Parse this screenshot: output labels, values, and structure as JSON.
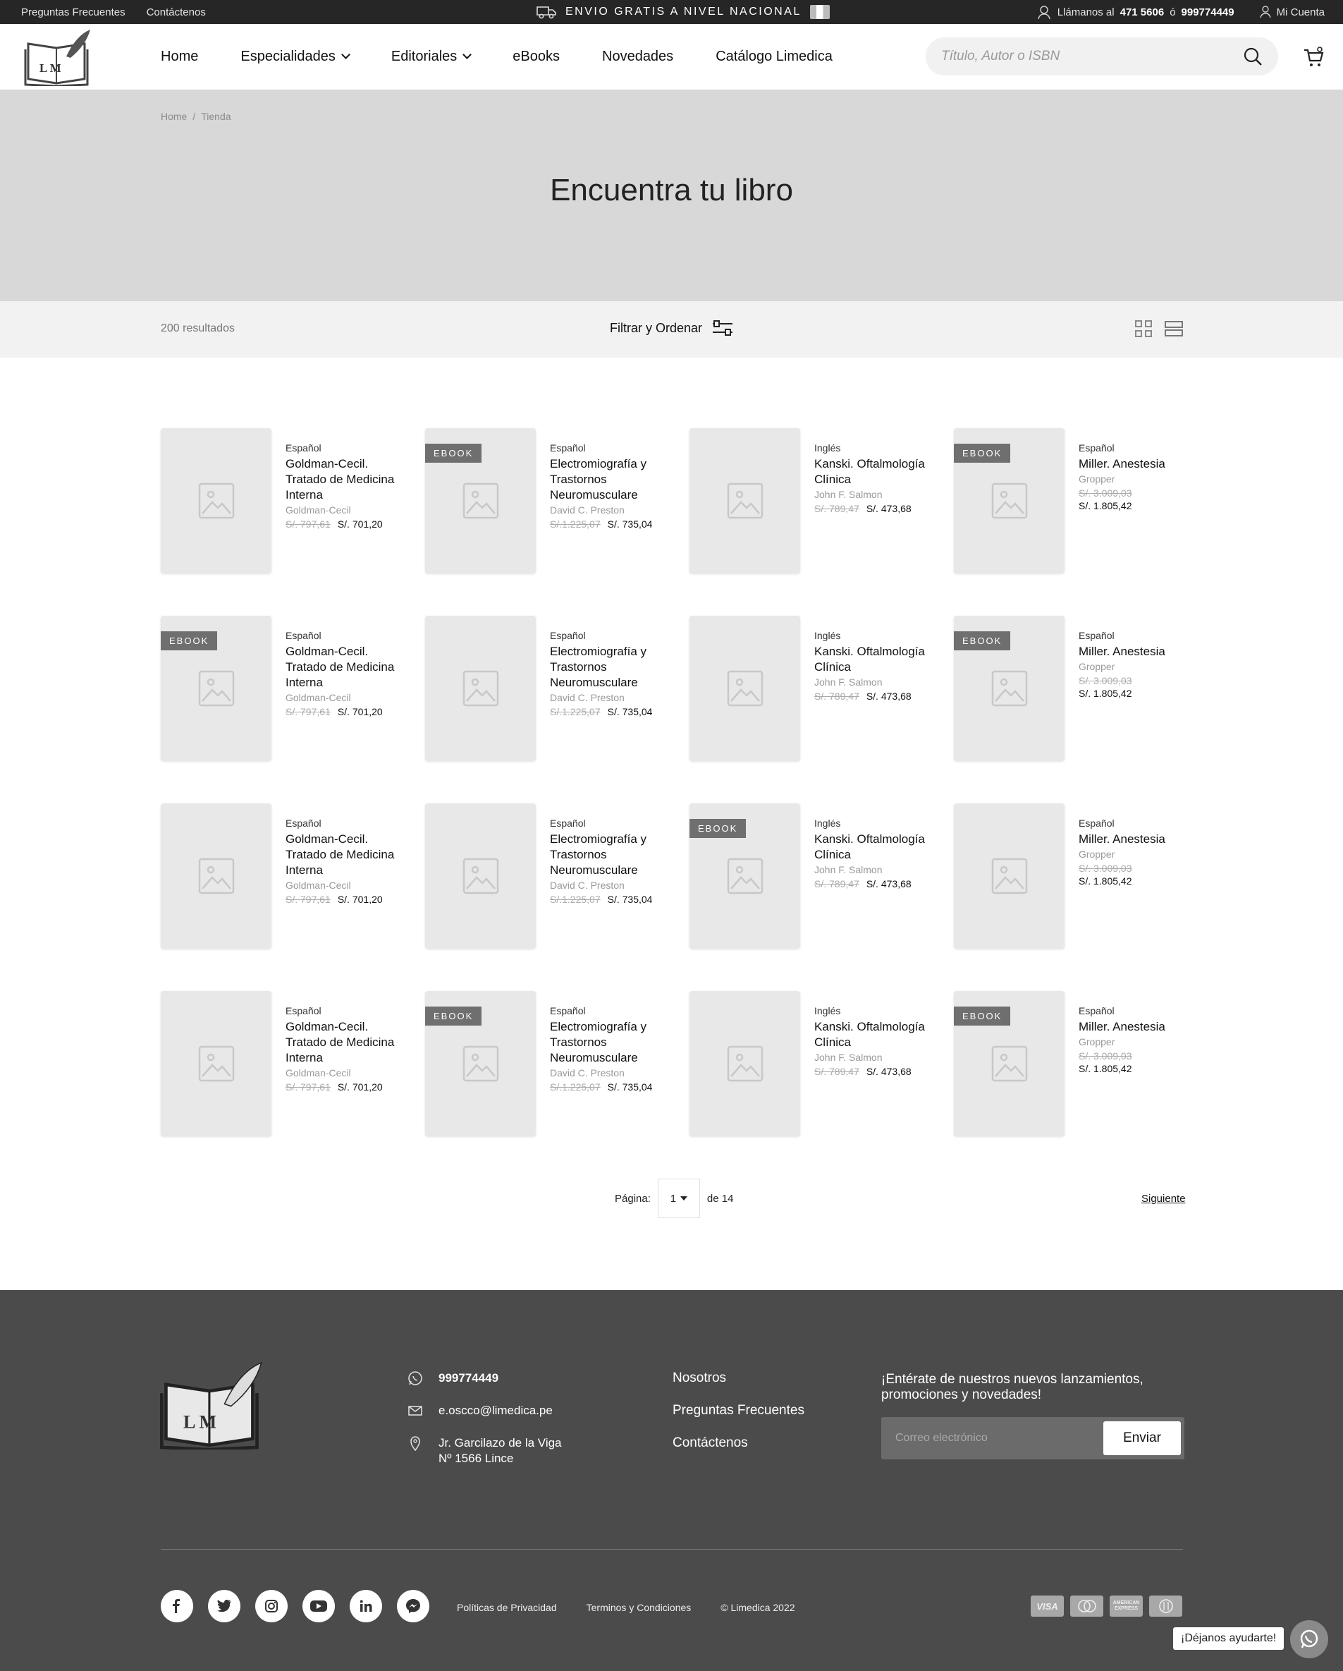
{
  "topbar": {
    "faq": "Preguntas Frecuentes",
    "contact": "Contáctenos",
    "shipping": "ENVIO GRATIS A NIVEL NACIONAL",
    "call_prefix": "Llámanos al",
    "phone1": "471 5606",
    "or": "ó",
    "phone2": "999774449",
    "account": "Mi Cuenta"
  },
  "nav": {
    "home": "Home",
    "especialidades": "Especialidades",
    "editoriales": "Editoriales",
    "ebooks": "eBooks",
    "novedades": "Novedades",
    "catalogo": "Catálogo Limedica"
  },
  "search": {
    "placeholder": "Título, Autor o ISBN"
  },
  "breadcrumb": {
    "home": "Home",
    "sep": "/",
    "current": "Tienda"
  },
  "hero": {
    "title": "Encuentra tu libro"
  },
  "toolbar": {
    "results": "200 resultados",
    "filter": "Filtrar y Ordenar"
  },
  "products": [
    {
      "badge": "",
      "lang": "Español",
      "title": "Goldman-Cecil. Tratado de Medicina Interna",
      "author": "Goldman-Cecil",
      "old_price": "S/. 797,61",
      "price": "S/. 701,20"
    },
    {
      "badge": "EBOOK",
      "lang": "Español",
      "title": "Electromiografía y Trastornos Neuromusculare",
      "author": "David C. Preston",
      "old_price": "S/.1.225,07",
      "price": "S/. 735,04"
    },
    {
      "badge": "",
      "lang": "Inglés",
      "title": "Kanski. Oftalmología Clínica",
      "author": "John F. Salmon",
      "old_price": "S/. 789,47",
      "price": "S/. 473,68"
    },
    {
      "badge": "EBOOK",
      "lang": "Español",
      "title": "Miller. Anestesia",
      "author": "Gropper",
      "old_price": "S/. 3.009,03",
      "price": "S/. 1.805,42"
    },
    {
      "badge": "EBOOK",
      "lang": "Español",
      "title": "Goldman-Cecil. Tratado de Medicina Interna",
      "author": "Goldman-Cecil",
      "old_price": "S/. 797,61",
      "price": "S/. 701,20"
    },
    {
      "badge": "",
      "lang": "Español",
      "title": "Electromiografía y Trastornos Neuromusculare",
      "author": "David C. Preston",
      "old_price": "S/.1.225,07",
      "price": "S/. 735,04"
    },
    {
      "badge": "",
      "lang": "Inglés",
      "title": "Kanski. Oftalmología Clínica",
      "author": "John F. Salmon",
      "old_price": "S/. 789,47",
      "price": "S/. 473,68"
    },
    {
      "badge": "EBOOK",
      "lang": "Español",
      "title": "Miller. Anestesia",
      "author": "Gropper",
      "old_price": "S/. 3.009,03",
      "price": "S/. 1.805,42"
    },
    {
      "badge": "",
      "lang": "Español",
      "title": "Goldman-Cecil. Tratado de Medicina Interna",
      "author": "Goldman-Cecil",
      "old_price": "S/. 797,61",
      "price": "S/. 701,20"
    },
    {
      "badge": "",
      "lang": "Español",
      "title": "Electromiografía y Trastornos Neuromusculare",
      "author": "David C. Preston",
      "old_price": "S/.1.225,07",
      "price": "S/. 735,04"
    },
    {
      "badge": "EBOOK",
      "lang": "Inglés",
      "title": "Kanski. Oftalmología Clínica",
      "author": "John F. Salmon",
      "old_price": "S/. 789,47",
      "price": "S/. 473,68"
    },
    {
      "badge": "",
      "lang": "Español",
      "title": "Miller. Anestesia",
      "author": "Gropper",
      "old_price": "S/. 3.009,03",
      "price": "S/. 1.805,42"
    },
    {
      "badge": "",
      "lang": "Español",
      "title": "Goldman-Cecil. Tratado de Medicina Interna",
      "author": "Goldman-Cecil",
      "old_price": "S/. 797,61",
      "price": "S/. 701,20"
    },
    {
      "badge": "EBOOK",
      "lang": "Español",
      "title": "Electromiografía y Trastornos Neuromusculare",
      "author": "David C. Preston",
      "old_price": "S/.1.225,07",
      "price": "S/. 735,04"
    },
    {
      "badge": "",
      "lang": "Inglés",
      "title": "Kanski. Oftalmología Clínica",
      "author": "John F. Salmon",
      "old_price": "S/. 789,47",
      "price": "S/. 473,68"
    },
    {
      "badge": "EBOOK",
      "lang": "Español",
      "title": "Miller. Anestesia",
      "author": "Gropper",
      "old_price": "S/. 3.009,03",
      "price": "S/. 1.805,42"
    }
  ],
  "pagination": {
    "label": "Página:",
    "current": "1",
    "of": "de 14",
    "next": "Siguiente"
  },
  "footer": {
    "phone": "999774449",
    "email": "e.oscco@limedica.pe",
    "address_line1": "Jr. Garcilazo de la Viga",
    "address_line2": "Nº 1566 Lince",
    "links": [
      "Nosotros",
      "Preguntas Frecuentes",
      "Contáctenos"
    ],
    "newsletter_text": "¡Entérate de nuestros nuevos lanzamientos, promociones y novedades!",
    "email_placeholder": "Correo electrónico",
    "send": "Enviar",
    "privacy": "Políticas de Privacidad",
    "terms": "Terminos y Condiciones",
    "copyright": "© Limedica 2022",
    "help": "¡Déjanos ayudarte!",
    "payment_cards": [
      "VISA",
      "mastercard",
      "american express",
      "diners"
    ],
    "social": [
      "facebook-icon",
      "twitter-icon",
      "instagram-icon",
      "youtube-icon",
      "linkedin-icon",
      "messenger-icon"
    ]
  },
  "logo": {
    "text": "L M"
  }
}
